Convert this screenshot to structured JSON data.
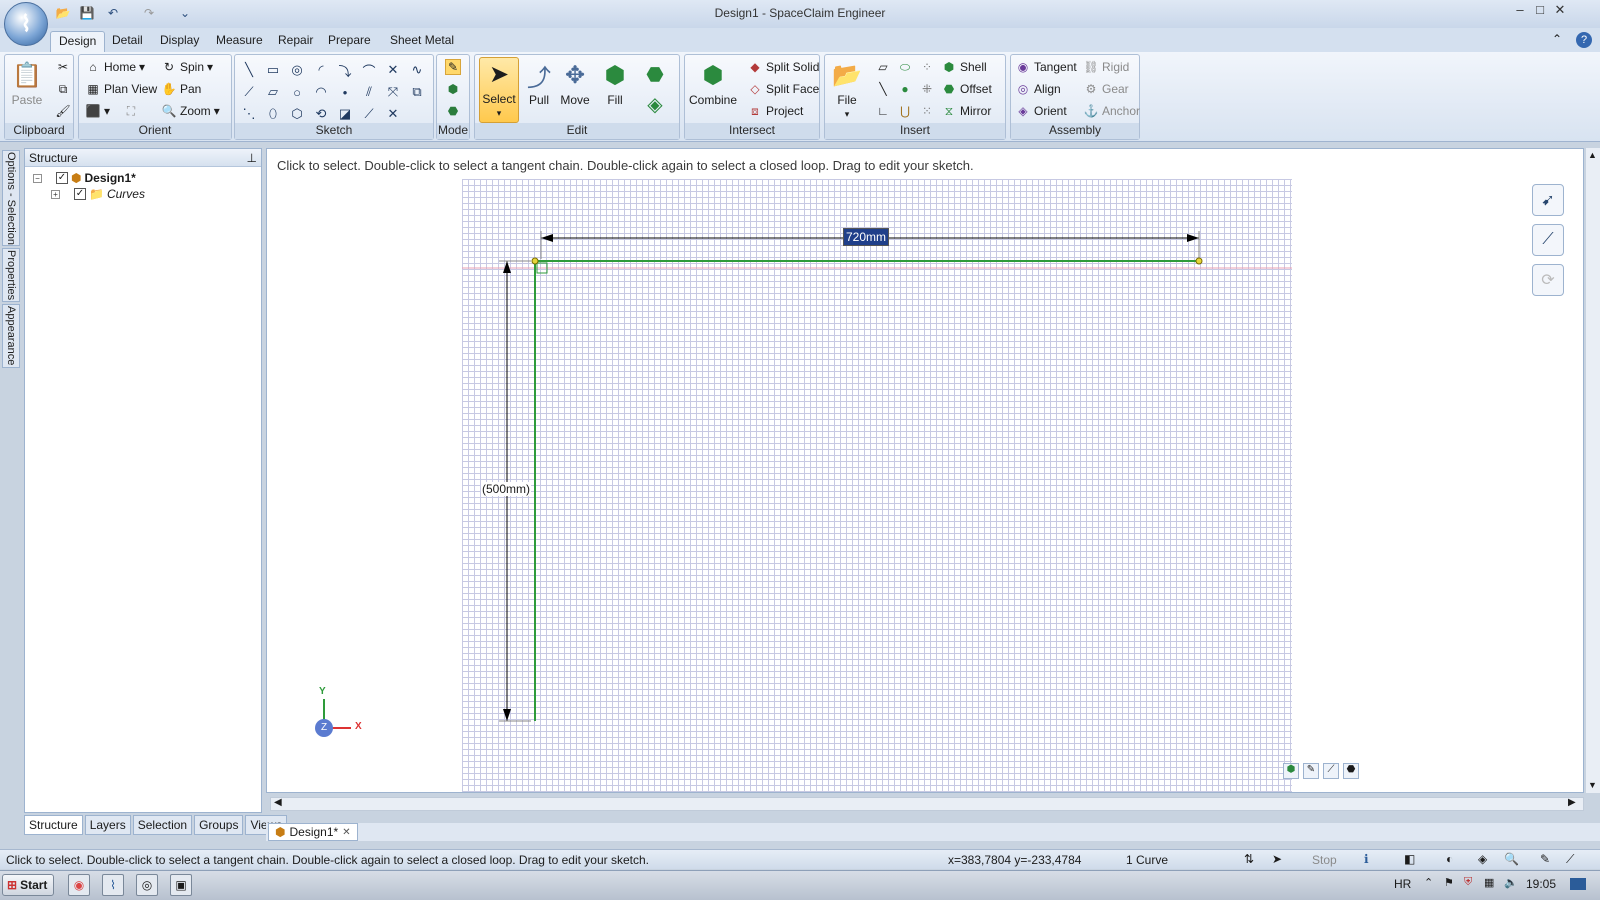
{
  "window": {
    "title": "Design1 - SpaceClaim Engineer",
    "minimize": "–",
    "maximize": "□",
    "close": "✕"
  },
  "quick_access": {
    "open": "📂",
    "save": "💾",
    "undo": "↶",
    "redo": "↷",
    "customize": "⌄"
  },
  "ribbon_tabs": [
    "Design",
    "Detail",
    "Display",
    "Measure",
    "Repair",
    "Prepare",
    "Sheet Metal"
  ],
  "ribbon_right": {
    "collapse": "⌃",
    "help": "?"
  },
  "clipboard": {
    "paste": "Paste",
    "label": "Clipboard"
  },
  "orient": {
    "home": "Home",
    "spin": "Spin",
    "plan_view": "Plan View",
    "pan": "Pan",
    "zoom": "Zoom",
    "label": "Orient"
  },
  "sketch": {
    "label": "Sketch"
  },
  "mode": {
    "label": "Mode"
  },
  "edit": {
    "select": "Select",
    "pull": "Pull",
    "move": "Move",
    "fill": "Fill",
    "label": "Edit"
  },
  "intersect": {
    "combine": "Combine",
    "split_solid": "Split Solid",
    "split_face": "Split Face",
    "project": "Project",
    "label": "Intersect"
  },
  "insert": {
    "file": "File",
    "shell": "Shell",
    "offset": "Offset",
    "mirror": "Mirror",
    "label": "Insert"
  },
  "assembly": {
    "tangent": "Tangent",
    "align": "Align",
    "orient": "Orient",
    "rigid": "Rigid",
    "gear": "Gear",
    "anchor": "Anchor",
    "label": "Assembly"
  },
  "side_tabs": [
    "Options - Selection",
    "Properties",
    "Appearance"
  ],
  "structure": {
    "title": "Structure",
    "pin": "⊥",
    "tree": [
      {
        "label": "Design1*",
        "expander": "−",
        "checked": "✓"
      },
      {
        "label": "Curves",
        "expander": "+",
        "checked": "✓"
      }
    ],
    "bottom_tabs": [
      "Structure",
      "Layers",
      "Selection",
      "Groups",
      "Views"
    ]
  },
  "viewport": {
    "hint": "Click to select. Double-click to select a tangent chain. Double-click again to select a closed loop. Drag to edit your sketch.",
    "dim_horizontal": "720mm",
    "dim_vertical": "(500mm)",
    "axis_y": "Y",
    "axis_x": "X",
    "axis_z": "Z"
  },
  "document_tab": {
    "label": "Design1*",
    "close": "✕"
  },
  "status": {
    "message": "Click to select. Double-click to select a tangent chain. Double-click again to select a closed loop. Drag to edit your sketch.",
    "coords": "x=383,7804  y=-233,4784",
    "selection": "1 Curve",
    "stop": "Stop"
  },
  "taskbar": {
    "start": "Start",
    "lang": "HR",
    "clock": "19:05"
  }
}
